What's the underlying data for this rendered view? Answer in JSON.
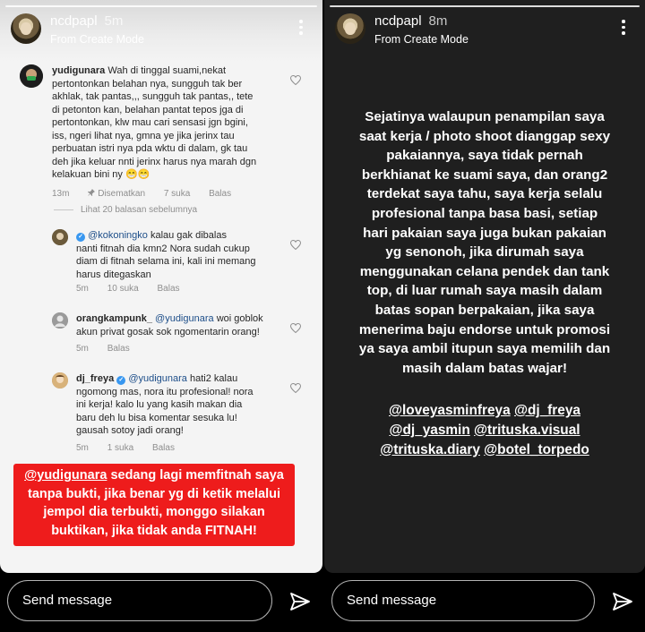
{
  "left_story": {
    "username": "ncdpapl",
    "time": "5m",
    "mode": "From Create Mode",
    "comments": [
      {
        "user": "yudigunara",
        "lines": [
          "Wah di tinggal suami,nekat",
          "pertontonkan belahan nya, sungguh tak ber",
          "akhlak,  tak pantas,,, sungguh tak pantas,, tete",
          "di petonton kan, belahan pantat tepos jga di",
          "pertontonkan, klw mau cari sensasi jgn bgini,",
          "iss, ngeri lihat nya, gmna ye jika jerinx tau",
          "perbuatan istri nya pda wktu di dalam, gk tau",
          "deh jika keluar nnti jerinx harus nya marah dgn",
          "kelakuan bini ny 😁😁"
        ],
        "age": "13m",
        "pinned": "Disematkan",
        "likes": "7 suka",
        "reply": "Balas"
      },
      {
        "view_replies": "Lihat 20 balasan sebelumnya"
      },
      {
        "mention": "@kokoningko",
        "lines": [
          " kalau gak dibalas",
          "nanti fitnah dia kmn2 Nora sudah cukup",
          "diam di fitnah selama ini, kali ini memang",
          "harus ditegaskan"
        ],
        "age": "5m",
        "likes": "10 suka",
        "reply": "Balas"
      },
      {
        "user": "orangkampunk_",
        "mention": "@yudigunara",
        "lines": [
          " woi goblok",
          "akun privat gosak sok ngomentarin orang!"
        ],
        "age": "5m",
        "reply": "Balas"
      },
      {
        "user": "dj_freya",
        "mention": "@yudigunara",
        "lines": [
          " hati2 kalau",
          "ngomong mas, nora itu profesional! nora",
          "ini kerja! kalo lu yang kasih makan dia",
          "baru deh lu bisa komentar sesuka lu!",
          "gausah sotoy jadi orang!"
        ],
        "age": "5m",
        "likes": "1 suka",
        "reply": "Balas"
      }
    ],
    "sticker": {
      "mention": "@yudigunara",
      "text_first": " sedang lagi memfitnah saya",
      "lines": [
        "tanpa bukti, jika benar yg di ketik melalui",
        "jempol dia terbukti, monggo silakan",
        "buktikan, jika tidak anda FITNAH!"
      ]
    },
    "send_placeholder": "Send message"
  },
  "right_story": {
    "username": "ncdpapl",
    "time": "8m",
    "mode": "From Create Mode",
    "statement_lines": [
      "Sejatinya walaupun penampilan saya",
      "saat kerja / photo shoot dianggap sexy",
      "pakaiannya, saya tidak pernah",
      "berkhianat ke suami saya, dan orang2",
      "terdekat saya tahu, saya kerja selalu",
      "profesional tanpa basa basi, setiap",
      "hari pakaian saya juga bukan pakaian",
      "yg senonoh, jika dirumah saya",
      "menggunakan celana pendek dan tank",
      "top, di luar rumah saya masih dalam",
      "batas sopan berpakaian, jika saya",
      "menerima baju endorse untuk promosi",
      "ya saya ambil itupun saya memilih dan",
      "masih dalam batas wajar!"
    ],
    "tags": [
      "@loveyasminfreya",
      "@dj_freya",
      "@dj_yasmin",
      "@trituska.visual",
      "@trituska.diary",
      "@botel_torpedo"
    ],
    "send_placeholder": "Send message"
  },
  "colors": {
    "sticker_red": "#ee1c1c",
    "right_bg": "#1f1f1f",
    "verified_blue": "#3897f0"
  }
}
